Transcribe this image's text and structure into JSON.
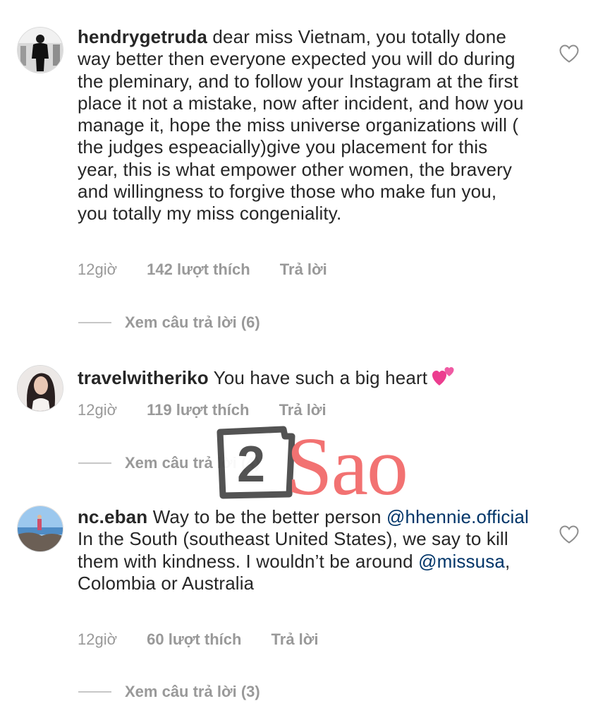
{
  "comments": [
    {
      "username": "hendrygetruda",
      "text": "dear miss Vietnam, you totally done way better then everyone expected you will do during the pleminary, and to follow your Instagram at the first place it not a mistake, now after incident, and how you manage it, hope the miss universe organizations will ( the judges espeacially)give you placement for this year, this is what empower other women, the bravery and willingness to forgive those who make fun you, you totally my miss congeniality.",
      "time": "12giờ",
      "likes": "142 lượt thích",
      "reply": "Trả lời",
      "view_replies": "Xem câu trả lời (6)",
      "like_icon": "heart-outline-icon"
    },
    {
      "username": "travelwitheriko",
      "text": "You have such a big heart",
      "emoji": "two-hearts-emoji",
      "time": "12giờ",
      "likes": "119 lượt thích",
      "reply": "Trả lời",
      "view_replies": "Xem câu trả lời (4)"
    },
    {
      "username": "nc.eban",
      "text_part1": "Way to be the better person",
      "mention1": "@hhennie.official",
      "text_part2": "In the South (southeast United States), we say to kill them with kindness. I wouldn’t be around",
      "mention2": "@missusa",
      "text_part3": ", Colombia or Australia",
      "time": "12giờ",
      "likes": "60 lượt thích",
      "reply": "Trả lời",
      "view_replies": "Xem câu trả lời (3)",
      "like_icon": "heart-outline-icon"
    }
  ],
  "watermark": {
    "digit": "2",
    "word": "Sao",
    "colors": {
      "box": "#4a4a4a",
      "word": "#f26b6b"
    }
  },
  "colors": {
    "text": "#262626",
    "meta": "#999999",
    "mention": "#003569",
    "divider": "#c7c7c7"
  }
}
